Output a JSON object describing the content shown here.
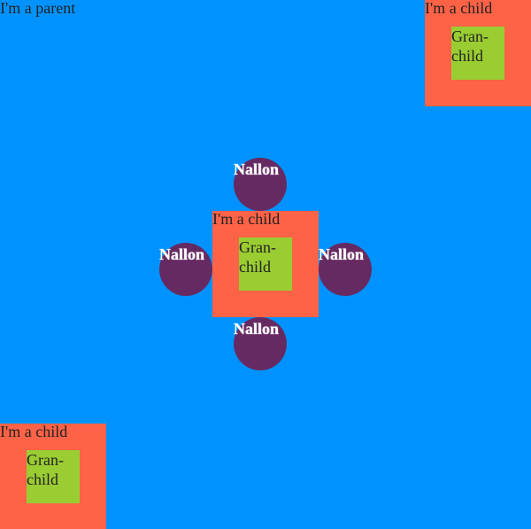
{
  "parent": {
    "label": "I'm a parent"
  },
  "children": [
    {
      "label": "I'm a child",
      "grandchild": {
        "label": "Gran-child"
      }
    },
    {
      "label": "I'm a child",
      "grandchild": {
        "label": "Gran-child"
      }
    },
    {
      "label": "I'm a child",
      "grandchild": {
        "label": "Gran-child"
      }
    }
  ],
  "nallons": [
    {
      "label": "Nallon"
    },
    {
      "label": "Nallon"
    },
    {
      "label": "Nallon"
    },
    {
      "label": "Nallon"
    }
  ],
  "colors": {
    "parent": "#0093ff",
    "child": "#ff6347",
    "grandchild": "#9acd32",
    "nallon": "#662a62"
  }
}
